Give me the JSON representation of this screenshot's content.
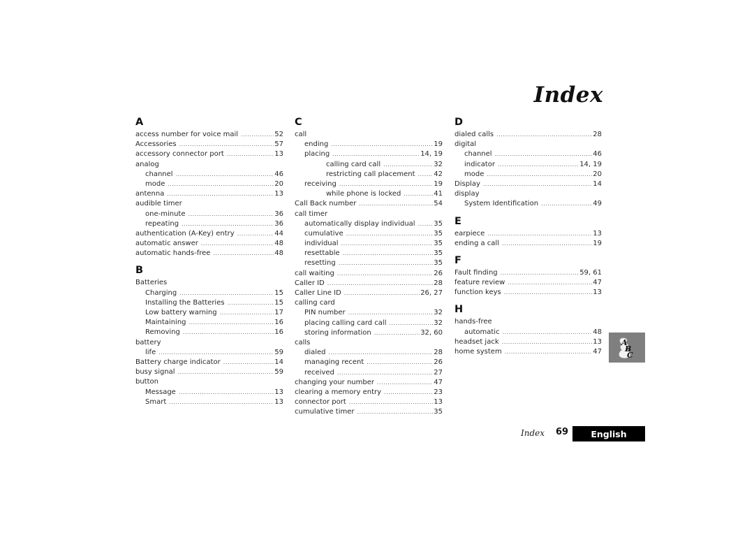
{
  "page": {
    "title": "Index",
    "footer": {
      "section_label": "Index",
      "page_number": "69",
      "language_tab": "English"
    },
    "tab_icon": "abc-index-icon",
    "colors": {
      "tab_background": "#7f7f7f",
      "language_tab_background": "#000000",
      "language_tab_text": "#ffffff"
    }
  },
  "columns": [
    {
      "sections": [
        {
          "letter": "A",
          "entries": [
            {
              "level": 0,
              "term": "access number for voice mail",
              "page": "52"
            },
            {
              "level": 0,
              "term": "Accessories",
              "page": "57"
            },
            {
              "level": 0,
              "term": "accessory connector port",
              "page": "13"
            },
            {
              "level": 0,
              "term": "analog",
              "page": ""
            },
            {
              "level": 1,
              "term": "channel",
              "page": "46"
            },
            {
              "level": 1,
              "term": "mode",
              "page": "20"
            },
            {
              "level": 0,
              "term": "antenna",
              "page": "13"
            },
            {
              "level": 0,
              "term": "audible timer",
              "page": ""
            },
            {
              "level": 1,
              "term": "one-minute",
              "page": "36"
            },
            {
              "level": 1,
              "term": "repeating",
              "page": "36"
            },
            {
              "level": 0,
              "term": "authentication (A-Key) entry",
              "page": "44"
            },
            {
              "level": 0,
              "term": "automatic answer",
              "page": "48"
            },
            {
              "level": 0,
              "term": "automatic hands-free",
              "page": "48"
            }
          ]
        },
        {
          "letter": "B",
          "entries": [
            {
              "level": 0,
              "term": "Batteries",
              "page": ""
            },
            {
              "level": 1,
              "term": "Charging",
              "page": "15"
            },
            {
              "level": 1,
              "term": "Installing the Batteries",
              "page": "15"
            },
            {
              "level": 1,
              "term": "Low battery warning",
              "page": "17"
            },
            {
              "level": 1,
              "term": "Maintaining",
              "page": "16"
            },
            {
              "level": 1,
              "term": "Removing",
              "page": "16"
            },
            {
              "level": 0,
              "term": "battery",
              "page": ""
            },
            {
              "level": 1,
              "term": "life",
              "page": "59"
            },
            {
              "level": 0,
              "term": "Battery charge indicator",
              "page": "14"
            },
            {
              "level": 0,
              "term": "busy signal",
              "page": "59"
            },
            {
              "level": 0,
              "term": "button",
              "page": ""
            },
            {
              "level": 1,
              "term": "Message",
              "page": "13"
            },
            {
              "level": 1,
              "term": "Smart",
              "page": "13"
            }
          ]
        }
      ]
    },
    {
      "sections": [
        {
          "letter": "C",
          "entries": [
            {
              "level": 0,
              "term": "call",
              "page": ""
            },
            {
              "level": 1,
              "term": "ending",
              "page": "19"
            },
            {
              "level": 1,
              "term": "placing",
              "page": "14, 19"
            },
            {
              "level": 2,
              "term": "calling card call",
              "page": "32"
            },
            {
              "level": 2,
              "term": "restricting call placement",
              "page": "42"
            },
            {
              "level": 1,
              "term": "receiving",
              "page": "19"
            },
            {
              "level": 2,
              "term": "while phone is locked",
              "page": "41"
            },
            {
              "level": 0,
              "term": "Call Back number",
              "page": "54"
            },
            {
              "level": 0,
              "term": "call timer",
              "page": ""
            },
            {
              "level": 1,
              "term": "automatically display individual",
              "page": "35"
            },
            {
              "level": 1,
              "term": "cumulative",
              "page": "35"
            },
            {
              "level": 1,
              "term": "individual",
              "page": "35"
            },
            {
              "level": 1,
              "term": "resettable",
              "page": "35"
            },
            {
              "level": 1,
              "term": "resetting",
              "page": "35"
            },
            {
              "level": 0,
              "term": "call waiting",
              "page": "26"
            },
            {
              "level": 0,
              "term": "Caller ID",
              "page": "28"
            },
            {
              "level": 0,
              "term": "Caller Line ID",
              "page": "26, 27"
            },
            {
              "level": 0,
              "term": "calling card",
              "page": ""
            },
            {
              "level": 1,
              "term": "PIN number",
              "page": "32"
            },
            {
              "level": 1,
              "term": "placing calling card call",
              "page": "32"
            },
            {
              "level": 1,
              "term": "storing information",
              "page": "32, 60"
            },
            {
              "level": 0,
              "term": "calls",
              "page": ""
            },
            {
              "level": 1,
              "term": "dialed",
              "page": "28"
            },
            {
              "level": 1,
              "term": "managing recent",
              "page": "26"
            },
            {
              "level": 1,
              "term": "received",
              "page": "27"
            },
            {
              "level": 0,
              "term": "changing your number",
              "page": "47"
            },
            {
              "level": 0,
              "term": "clearing a memory entry",
              "page": "23"
            },
            {
              "level": 0,
              "term": "connector port",
              "page": "13"
            },
            {
              "level": 0,
              "term": "cumulative timer",
              "page": "35"
            }
          ]
        }
      ]
    },
    {
      "sections": [
        {
          "letter": "D",
          "entries": [
            {
              "level": 0,
              "term": "dialed calls",
              "page": "28"
            },
            {
              "level": 0,
              "term": "digital",
              "page": ""
            },
            {
              "level": 1,
              "term": "channel",
              "page": "46"
            },
            {
              "level": 1,
              "term": "indicator",
              "page": "14, 19"
            },
            {
              "level": 1,
              "term": "mode",
              "page": "20"
            },
            {
              "level": 0,
              "term": "Display",
              "page": "14"
            },
            {
              "level": 0,
              "term": "display",
              "page": ""
            },
            {
              "level": 1,
              "term": "System Identification",
              "page": "49"
            }
          ]
        },
        {
          "letter": "E",
          "entries": [
            {
              "level": 0,
              "term": "earpiece",
              "page": "13"
            },
            {
              "level": 0,
              "term": "ending a call",
              "page": "19"
            }
          ]
        },
        {
          "letter": "F",
          "entries": [
            {
              "level": 0,
              "term": "Fault finding",
              "page": "59, 61"
            },
            {
              "level": 0,
              "term": "feature review",
              "page": "47"
            },
            {
              "level": 0,
              "term": "function keys",
              "page": "13"
            }
          ]
        },
        {
          "letter": "H",
          "entries": [
            {
              "level": 0,
              "term": "hands-free",
              "page": ""
            },
            {
              "level": 1,
              "term": "automatic",
              "page": "48"
            },
            {
              "level": 0,
              "term": "headset jack",
              "page": "13"
            },
            {
              "level": 0,
              "term": "home system",
              "page": "47"
            }
          ]
        }
      ]
    }
  ]
}
